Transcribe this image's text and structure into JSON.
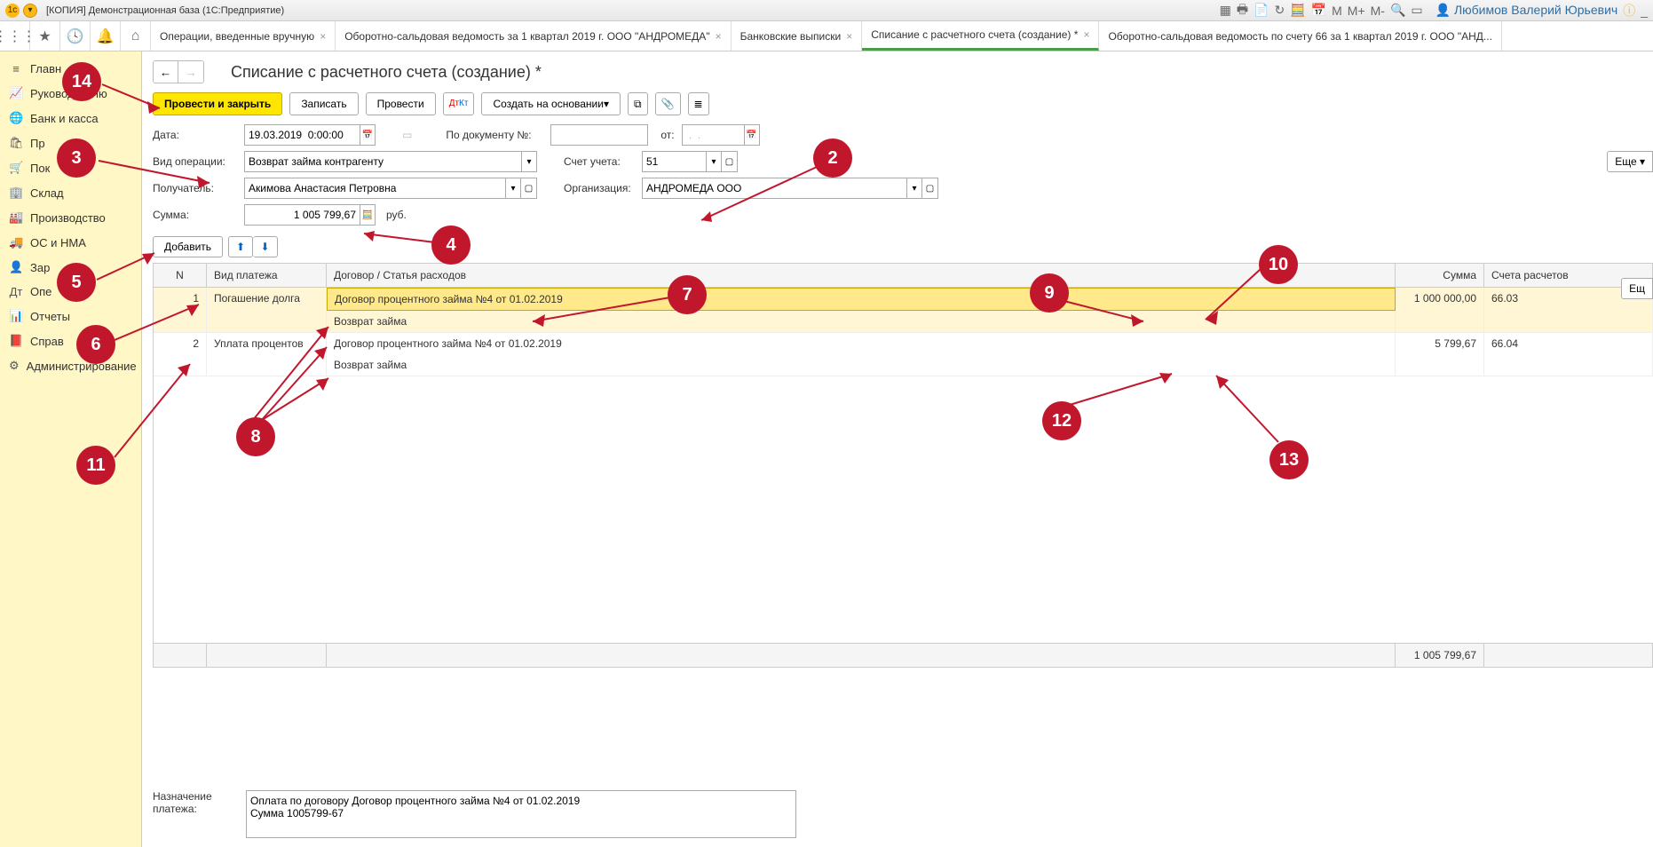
{
  "title": "[КОПИЯ] Демонстрационная база  (1С:Предприятие)",
  "user": "Любимов Валерий Юрьевич",
  "topIcons": [
    "M",
    "M+",
    "M-"
  ],
  "tabs": [
    {
      "label": "Операции, введенные вручную",
      "close": true
    },
    {
      "label": "Оборотно-сальдовая ведомость за 1 квартал 2019 г. ООО \"АНДРОМЕДА\"",
      "close": true
    },
    {
      "label": "Банковские выписки",
      "close": true
    },
    {
      "label": "Списание с расчетного счета (создание) *",
      "close": true,
      "active": true
    },
    {
      "label": "Оборотно-сальдовая ведомость по счету 66 за 1 квартал 2019 г. ООО \"АНД...",
      "close": false
    }
  ],
  "sidebar": [
    {
      "icon": "≡",
      "label": "Главн"
    },
    {
      "icon": "📈",
      "label": "Руководителю"
    },
    {
      "icon": "🌐",
      "label": "Банк и касса"
    },
    {
      "icon": "🛍",
      "label": "Пр"
    },
    {
      "icon": "🛒",
      "label": "Пок"
    },
    {
      "icon": "🏢",
      "label": "Склад"
    },
    {
      "icon": "🏭",
      "label": "Производство"
    },
    {
      "icon": "🚚",
      "label": "ОС и НМА"
    },
    {
      "icon": "👤",
      "label": "Зар"
    },
    {
      "icon": "Дт",
      "label": "Опе"
    },
    {
      "icon": "📊",
      "label": "Отчеты"
    },
    {
      "icon": "📕",
      "label": "Справ"
    },
    {
      "icon": "⚙",
      "label": "Администрирование"
    }
  ],
  "pageTitle": "Списание с расчетного счета (создание) *",
  "buttons": {
    "postClose": "Провести и закрыть",
    "save": "Записать",
    "post": "Провести",
    "createFrom": "Создать на основании",
    "more": "Еще",
    "add": "Добавить"
  },
  "form": {
    "dateLabel": "Дата:",
    "dateValue": "19.03.2019  0:00:00",
    "docNumLabel": "По документу №:",
    "docNumValue": "",
    "fromLabel": "от:",
    "fromValue": " .  .    ",
    "opTypeLabel": "Вид операции:",
    "opTypeValue": "Возврат займа контрагенту",
    "accountLabel": "Счет учета:",
    "accountValue": "51",
    "recipientLabel": "Получатель:",
    "recipientValue": "Акимова Анастасия Петровна",
    "orgLabel": "Организация:",
    "orgValue": "АНДРОМЕДА ООО",
    "sumLabel": "Сумма:",
    "sumValue": "1 005 799,67",
    "currency": "руб."
  },
  "tableHeaders": {
    "n": "N",
    "type": "Вид платежа",
    "contract": "Договор / Статья расходов",
    "sum": "Сумма",
    "acct": "Счета расчетов"
  },
  "tableRows": [
    {
      "n": "1",
      "type": "Погашение долга",
      "contract": "Договор процентного займа №4 от 01.02.2019",
      "sub": "Возврат займа",
      "sum": "1 000 000,00",
      "acct": "66.03",
      "selected": true
    },
    {
      "n": "2",
      "type": "Уплата процентов",
      "contract": "Договор процентного займа №4 от 01.02.2019",
      "sub": "Возврат займа",
      "sum": "5 799,67",
      "acct": "66.04",
      "selected": false
    }
  ],
  "tableFooter": {
    "sum": "1 005 799,67"
  },
  "purposeLabel": "Назначение платежа:",
  "purposeValue": "Оплата по договору Договор процентного займа №4 от 01.02.2019\nСумма 1005799-67",
  "callouts": [
    "2",
    "3",
    "4",
    "5",
    "6",
    "7",
    "8",
    "9",
    "10",
    "11",
    "12",
    "13",
    "14"
  ]
}
